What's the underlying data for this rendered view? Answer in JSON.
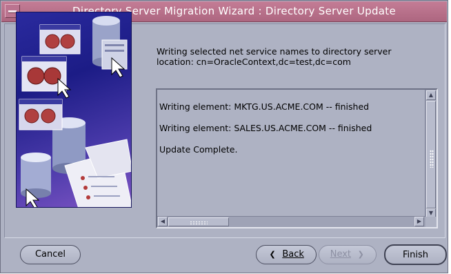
{
  "window": {
    "title": "Directory Server Migration Wizard : Directory Server Update"
  },
  "description": {
    "line1": "Writing selected net service names to directory server",
    "line2": "location: cn=OracleContext,dc=test,dc=com"
  },
  "log": {
    "lines": [
      "Writing element: MKTG.US.ACME.COM -- finished",
      "Writing element: SALES.US.ACME.COM -- finished",
      "Update Complete."
    ]
  },
  "buttons": {
    "cancel": "Cancel",
    "back": "Back",
    "next": "Next",
    "finish": "Finish"
  },
  "icons": {
    "window_menu": "window-menu-icon",
    "back_arrow": "chevron-left-icon",
    "next_arrow": "chevron-right-icon"
  },
  "colors": {
    "titlebar": "#ad6680",
    "window_background": "#aeb2c3",
    "art_background": "#1c1c86"
  }
}
